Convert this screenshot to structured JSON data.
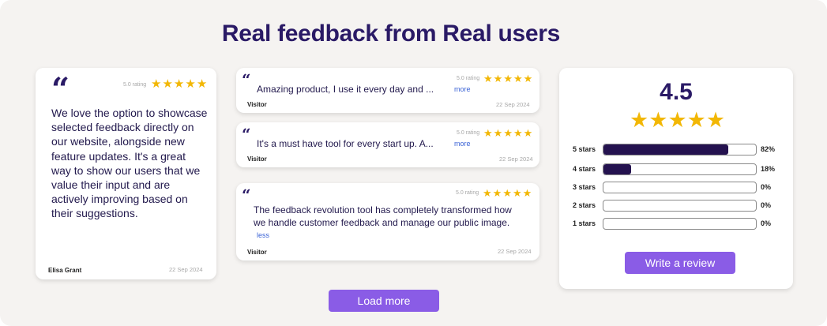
{
  "title": "Real feedback from Real users",
  "featured": {
    "quote_icon": "quote-icon",
    "rating_label": "5.0 rating",
    "stars": 5,
    "text": "We love the option to showcase selected feedback directly on our website, alongside new feature updates. It's a great way to show our users that we value their input and are actively improving based on their suggestions.",
    "author": "Elisa Grant",
    "date": "22 Sep 2024"
  },
  "reviews": [
    {
      "rating_label": "5.0 rating",
      "stars": 5,
      "text": "Amazing product, I use it every day and ...",
      "link": "more",
      "author": "Visitor",
      "date": "22 Sep 2024"
    },
    {
      "rating_label": "5.0 rating",
      "stars": 5,
      "text": "It's a must have tool for every start up. A...",
      "link": "more",
      "author": "Visitor",
      "date": "22 Sep 2024"
    },
    {
      "rating_label": "5.0 rating",
      "stars": 5,
      "text": "The feedback revolution tool has completely transformed how we handle customer feedback and manage our public image.",
      "link": "less",
      "author": "Visitor",
      "date": "22 Sep 2024"
    }
  ],
  "summary": {
    "average": "4.5",
    "stars": 5,
    "distribution": [
      {
        "label": "5 stars",
        "pct": "82%",
        "fraction": 0.82
      },
      {
        "label": "4 stars",
        "pct": "18%",
        "fraction": 0.18
      },
      {
        "label": "3 stars",
        "pct": "0%",
        "fraction": 0
      },
      {
        "label": "2 stars",
        "pct": "0%",
        "fraction": 0
      },
      {
        "label": "1 stars",
        "pct": "0%",
        "fraction": 0
      }
    ],
    "write_review_label": "Write a review"
  },
  "load_more_label": "Load more",
  "colors": {
    "accent": "#8a5ce6",
    "star": "#f2b705",
    "bar_fill": "#24124f",
    "heading": "#2a1a66",
    "link": "#3b63d6"
  }
}
